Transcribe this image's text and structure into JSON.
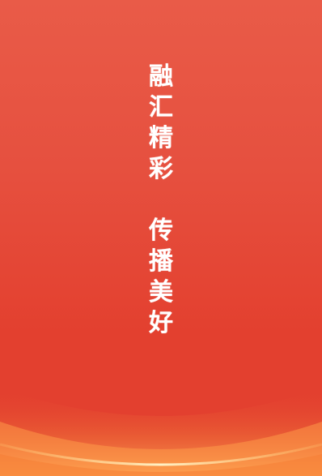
{
  "splash": {
    "slogan_line_1": [
      "融",
      "汇",
      "精",
      "彩"
    ],
    "slogan_line_2": [
      "传",
      "播",
      "美",
      "好"
    ]
  },
  "colors": {
    "background_top": "#e95b48",
    "background_bottom": "#e3402f",
    "glow": "#ffc36a",
    "text": "#ffffff"
  }
}
